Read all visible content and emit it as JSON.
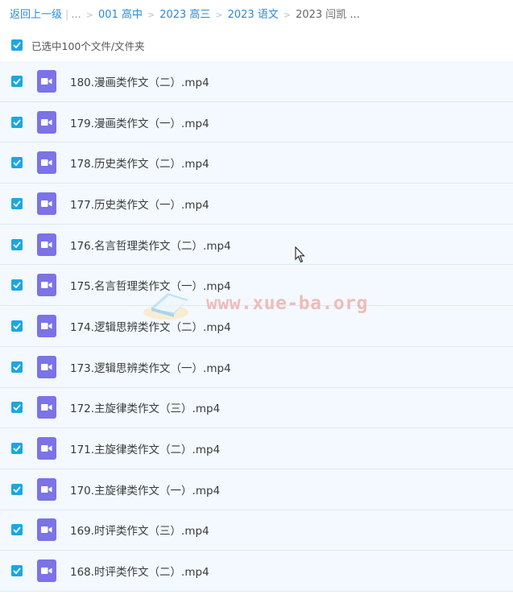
{
  "breadcrumb": {
    "back": "返回上一级",
    "ellipsis": "...",
    "items": [
      "001 高中",
      "2023 高三",
      "2023 语文"
    ],
    "current": "2023 闫凯 ..."
  },
  "selection": {
    "label": "已选中100个文件/文件夹",
    "checked": true
  },
  "files": [
    {
      "name": "180.漫画类作文（二）.mp4",
      "checked": true
    },
    {
      "name": "179.漫画类作文（一）.mp4",
      "checked": true
    },
    {
      "name": "178.历史类作文（二）.mp4",
      "checked": true
    },
    {
      "name": "177.历史类作文（一）.mp4",
      "checked": true
    },
    {
      "name": "176.名言哲理类作文（二）.mp4",
      "checked": true
    },
    {
      "name": "175.名言哲理类作文（一）.mp4",
      "checked": true
    },
    {
      "name": "174.逻辑思辨类作文（二）.mp4",
      "checked": true
    },
    {
      "name": "173.逻辑思辨类作文（一）.mp4",
      "checked": true
    },
    {
      "name": "172.主旋律类作文（三）.mp4",
      "checked": true
    },
    {
      "name": "171.主旋律类作文（二）.mp4",
      "checked": true
    },
    {
      "name": "170.主旋律类作文（一）.mp4",
      "checked": true
    },
    {
      "name": "169.时评类作文（三）.mp4",
      "checked": true
    },
    {
      "name": "168.时评类作文（二）.mp4",
      "checked": true
    }
  ],
  "file_icon": "video-file-icon",
  "watermark": {
    "text": "www.xue-ba.org"
  },
  "colors": {
    "accent": "#1ba7e2",
    "link": "#2b8ad7",
    "video_icon": "#7b73e6",
    "row_bg": "#f3f9fe"
  }
}
